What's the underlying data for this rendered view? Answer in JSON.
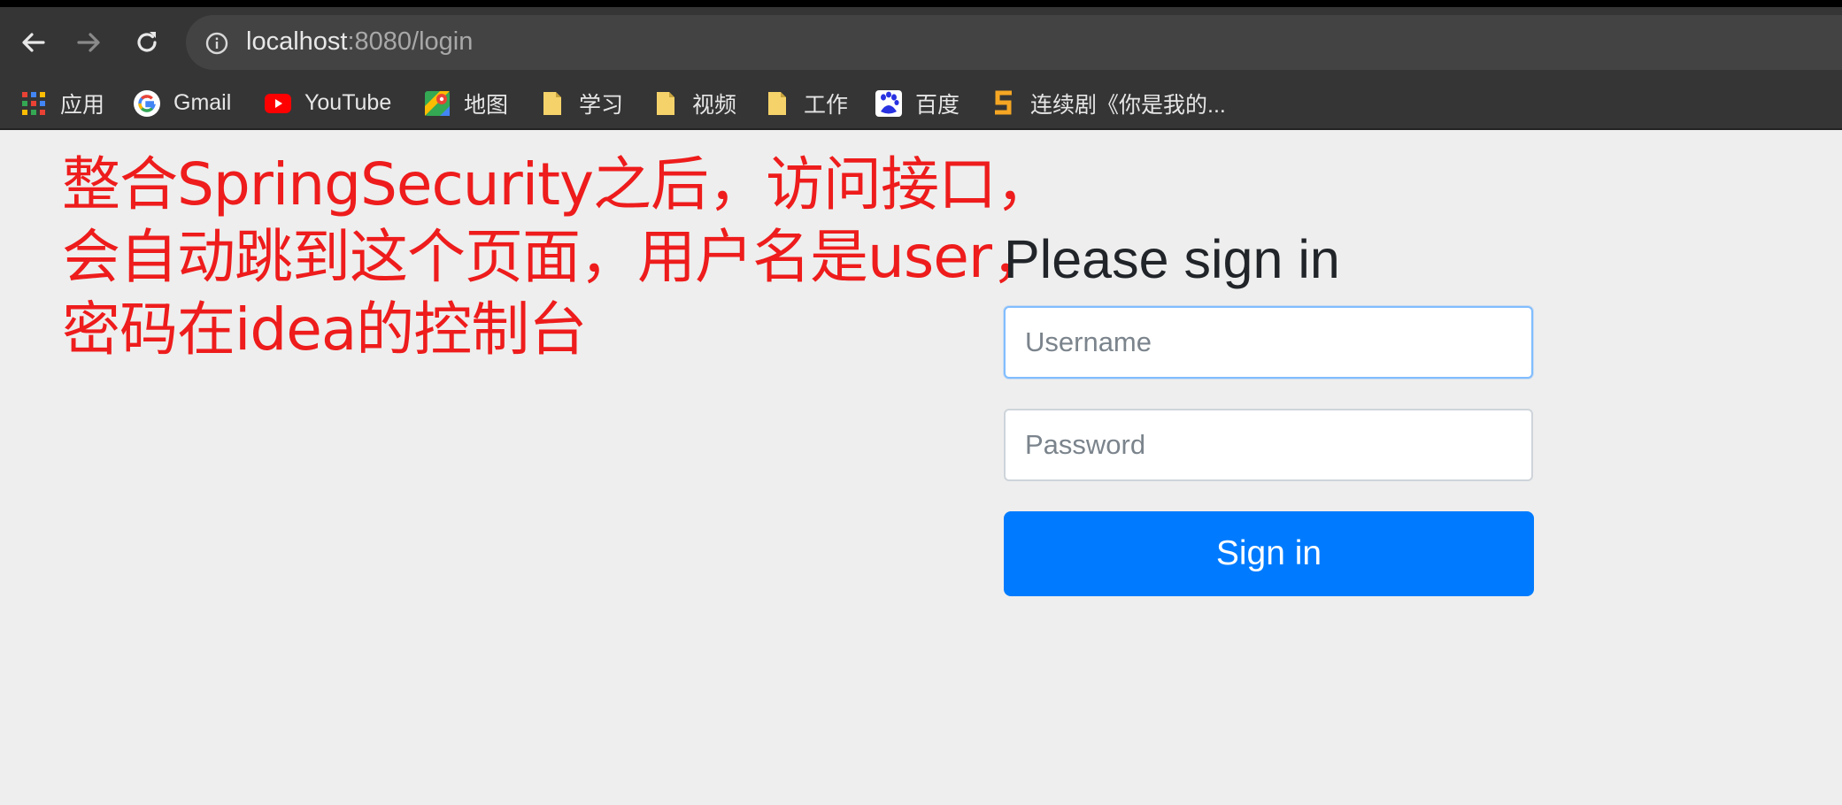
{
  "browser": {
    "url_host": "localhost",
    "url_rest": ":8080/login",
    "nav": {
      "back_icon": "arrow-left-icon",
      "forward_icon": "arrow-right-icon",
      "reload_icon": "reload-icon",
      "info_icon": "info-circle-icon"
    },
    "bookmarks": [
      {
        "label": "应用",
        "icon": "apps-grid-icon"
      },
      {
        "label": "Gmail",
        "icon": "google-icon"
      },
      {
        "label": "YouTube",
        "icon": "youtube-icon"
      },
      {
        "label": "地图",
        "icon": "maps-icon"
      },
      {
        "label": "学习",
        "icon": "folder-icon"
      },
      {
        "label": "视频",
        "icon": "folder-icon"
      },
      {
        "label": "工作",
        "icon": "folder-icon"
      },
      {
        "label": "百度",
        "icon": "baidu-icon"
      },
      {
        "label": "连续剧《你是我的...",
        "icon": "s-logo-icon"
      }
    ]
  },
  "annotation": {
    "line1": "整合SpringSecurity之后，访问接口，",
    "line2": "会自动跳到这个页面，用户名是user，",
    "line3": "密码在idea的控制台",
    "color": "#ee1c1c"
  },
  "login": {
    "heading": "Please sign in",
    "username_placeholder": "Username",
    "password_placeholder": "Password",
    "submit_label": "Sign in",
    "accent": "#007bff"
  }
}
